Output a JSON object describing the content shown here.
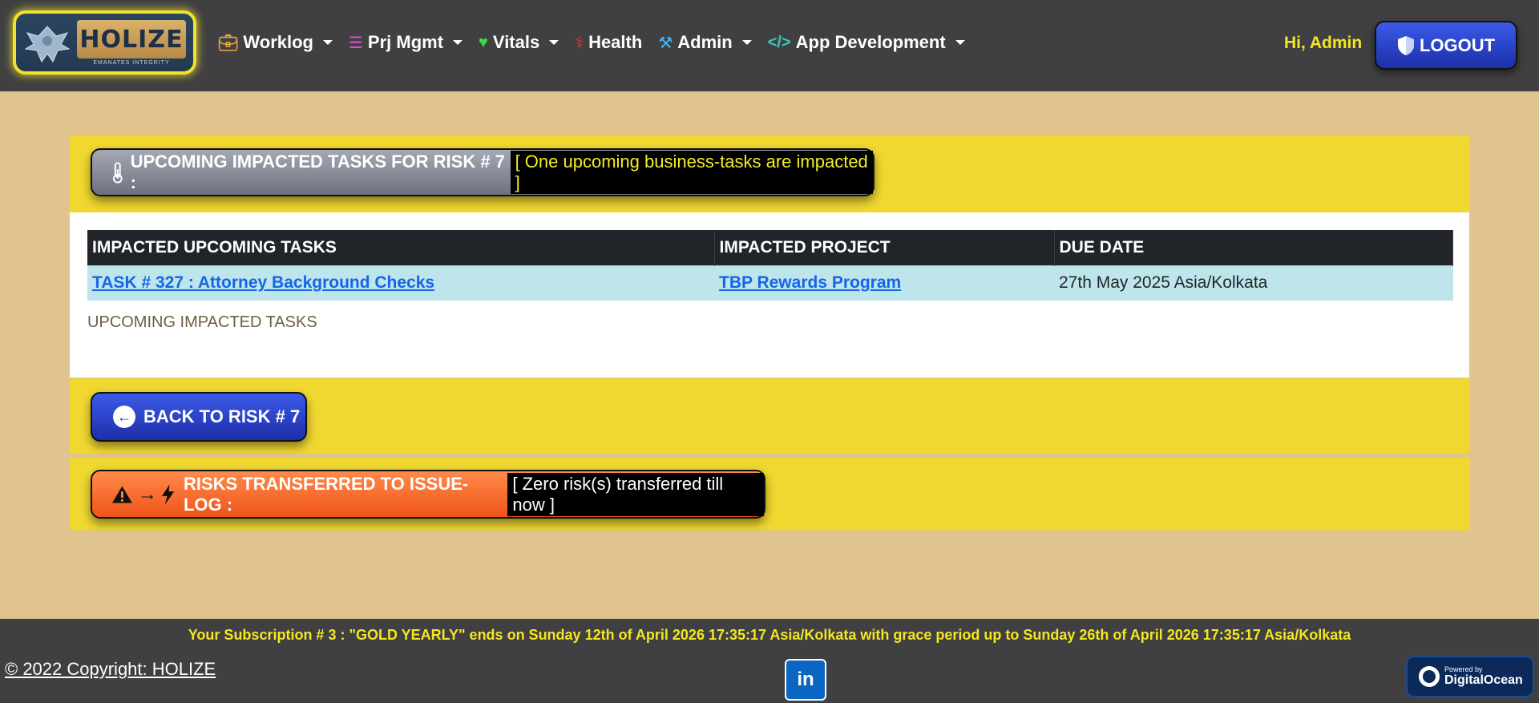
{
  "brand": {
    "name": "HOLIZE",
    "tagline": "EMANATES INTEGRITY"
  },
  "nav": {
    "items": [
      {
        "label": "Worklog",
        "icon": "briefcase-icon",
        "dropdown": true
      },
      {
        "label": "Prj Mgmt",
        "icon": "sitemap-icon",
        "dropdown": true
      },
      {
        "label": "Vitals",
        "icon": "heartbeat-icon",
        "dropdown": true
      },
      {
        "label": "Health",
        "icon": "stethoscope-icon",
        "dropdown": false
      },
      {
        "label": "Admin",
        "icon": "hammer-icon",
        "dropdown": true
      },
      {
        "label": "App Development",
        "icon": "code-icon",
        "dropdown": true
      }
    ],
    "greeting": "Hi, Admin",
    "logout_label": "LOGOUT"
  },
  "impacted": {
    "heading": "UPCOMING IMPACTED TASKS FOR RISK # 7 :",
    "highlight": "[ One upcoming business-tasks are impacted ]",
    "columns": [
      "IMPACTED UPCOMING TASKS",
      "IMPACTED PROJECT",
      "DUE DATE"
    ],
    "rows": [
      {
        "task": "TASK # 327 : Attorney Background Checks",
        "project": "TBP Rewards Program",
        "due": "27th May 2025 Asia/Kolkata"
      }
    ],
    "caption": "UPCOMING IMPACTED TASKS"
  },
  "back": {
    "label": "BACK TO RISK # 7"
  },
  "transfer": {
    "heading": "RISKS TRANSFERRED TO ISSUE-LOG :",
    "highlight": "[ Zero risk(s) transferred till now ]"
  },
  "footer": {
    "subscription": "Your Subscription # 3 : \"GOLD YEARLY\" ends on Sunday 12th of April 2026 17:35:17 Asia/Kolkata with grace period up to Sunday 26th of April 2026 17:35:17 Asia/Kolkata",
    "copyright": "© 2022 Copyright: HOLIZE",
    "linkedin": "in",
    "do_small": "Powered by",
    "do_big": "DigitalOcean"
  },
  "colors": {
    "navbar": "#404042",
    "page_bg": "#e0c38e",
    "card_yellow": "#f0d831",
    "accent_yellow": "#f4e621",
    "logout_blue": "#1c2fa8",
    "transfer_orange": "#f0541a"
  }
}
